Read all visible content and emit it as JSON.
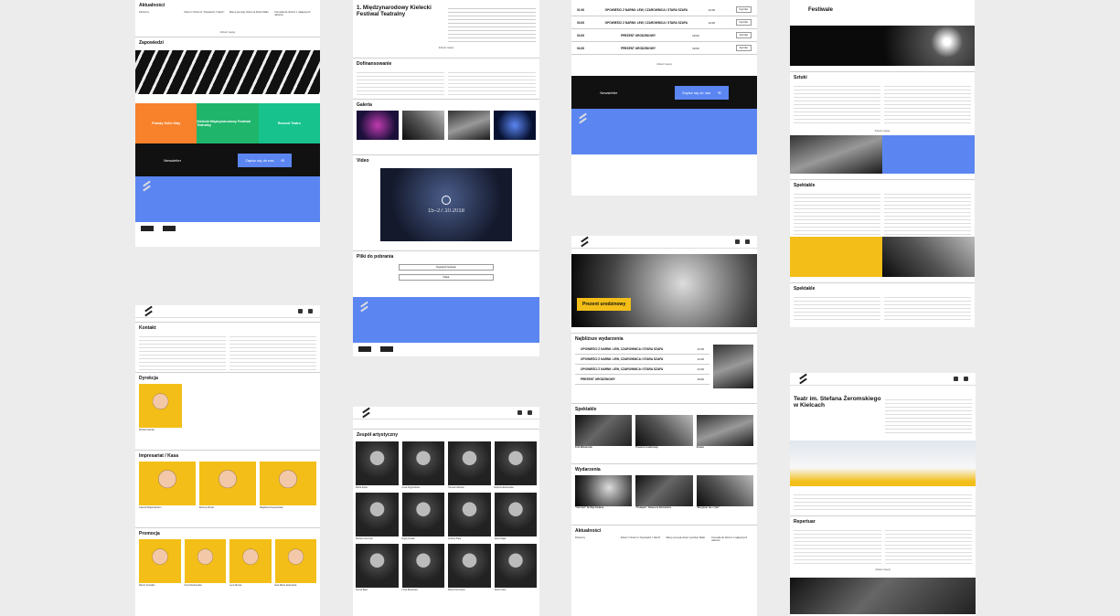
{
  "col1": {
    "news_heading": "Aktualności",
    "news": [
      {
        "label": "Partnerzy",
        "title": "",
        "text": ""
      },
      {
        "label": "",
        "title": "Dzieci z Ubrań to \"Opowieści z Narnii\"",
        "text": ""
      },
      {
        "label": "",
        "title": "Mamy pomysły dzieci na Dzień Matki",
        "text": ""
      },
      {
        "label": "",
        "title": "Komedia do złożoni z najlepszych aktorów",
        "text": ""
      }
    ],
    "more": "Zobacz więcej",
    "announcements_heading": "Zapowiedzi",
    "tiles": [
      "Pokaży Gelio Kidy",
      "Kielecki Międzynarodowy Festiwal Teatralny",
      "Remont Teatru"
    ],
    "newsletter": "Newsletter",
    "subscribe": "Zapisz się do nas",
    "contacts_heading": "Kontakt",
    "directors_heading": "Dyrekcja",
    "director_name": "Michał Kotański",
    "impresariat_heading": "Impresariat / Kasa",
    "impresariat": [
      "Jolanta Wojtaszkiewicz",
      "Bożena Moniat",
      "Magdalena Kęsarowska"
    ],
    "promo_heading": "Promocja",
    "promo": [
      "Marcin Kowalski",
      "Ilona Paczkowska",
      "Lena Skrzek",
      "Ewa Maria Jankowska"
    ]
  },
  "col2": {
    "festival_title": "1. Międzynarodowy Kielecki Festiwal Teatralny",
    "more": "Zobacz więcej",
    "funding_heading": "Dofinansowanie",
    "gallery_heading": "Galeria",
    "video_heading": "Video",
    "video_date": "15–27.10.2018",
    "downloads_heading": "Pliki do pobrania",
    "downloads": [
      "Regulamin festiwalu",
      "Plakat"
    ],
    "team_heading": "Zespół artystyczny",
    "team": [
      "Marta Zięba",
      "Anna Pogorzelska",
      "Tamara Kaliszek",
      "Edyta Łukaszewska",
      "Barbara Gierczak",
      "Edyta Nowak",
      "Andrzej Plata",
      "Jacek Mąka",
      "Teresa Bajor",
      "Łucja Bielawska",
      "Maria Kaczmarek",
      "Jacek Kubis"
    ]
  },
  "col3": {
    "events": [
      {
        "date": "01.06",
        "title": "OPOWIEŚCI Z NARNII: LEW, CZAROWNICA I STARA SZAFA",
        "time": "11:00"
      },
      {
        "date": "03.06",
        "title": "OPOWIEŚCI Z NARNII: LEW, CZAROWNICA I STARA SZAFA",
        "time": "11:00"
      },
      {
        "date": "03.06",
        "title": "PREZENT URODZINOWY",
        "time": "19:00"
      },
      {
        "date": "04.06",
        "title": "PREZENT URODZINOWY",
        "time": "19:00"
      }
    ],
    "buy_label": "Kup bilet",
    "more": "Zobacz więcej",
    "newsletter": "Newsletter",
    "subscribe": "Zapisz się do nas",
    "hero_title": "Prezent urodzinowy",
    "upcoming_heading": "Najbliższe wydarzenia",
    "upcoming": [
      {
        "title": "OPOWIEŚCI Z NARNII: LEW, CZAROWNICA I STARA SZAFA",
        "time": "11:00"
      },
      {
        "title": "OPOWIEŚCI Z NARNII: LEW, CZAROWNICA I STARA SZAFA",
        "time": "11:00"
      },
      {
        "title": "OPOWIEŚCI Z NARNII: LEW, CZAROWNICA I STARA SZAFA",
        "time": "11:00"
      },
      {
        "title": "PREZENT URODZINOWY",
        "time": "19:00"
      }
    ],
    "shows_heading": "Spektakle",
    "shows": [
      "Król Wiewiórek",
      "Prezent urodzinowy",
      "Zaraza"
    ],
    "publications_heading": "Wydarzenia",
    "publications": [
      "\"Internat\" Serhija Żadana",
      "\"Pułapka\" Tadeusza Różewicza",
      "\"Bergman nie z tyłu\""
    ],
    "news_heading": "Aktualności",
    "news": [
      "Partnerzy",
      "Dzieci z Ubrań to \"Opowieści z Narnii\"",
      "Mamy pomysły dzieci na Dzień Matki",
      "Komedia do złożoni z najlepszych aktorów"
    ]
  },
  "col4": {
    "festivals_heading": "Festiwale",
    "art_heading": "Sztuki",
    "shows_heading": "Spektakle",
    "shows2_heading": "Spektakle",
    "theater_title": "Teatr im. Stefana Żeromskiego w Kielcach",
    "repertoire_heading": "Repertuar",
    "more": "Zobacz więcej"
  },
  "colors": {
    "blue": "#5b86f2",
    "yellow": "#f3be18",
    "orange": "#f7822b",
    "green": "#1fb56b",
    "teal": "#17c28c"
  }
}
